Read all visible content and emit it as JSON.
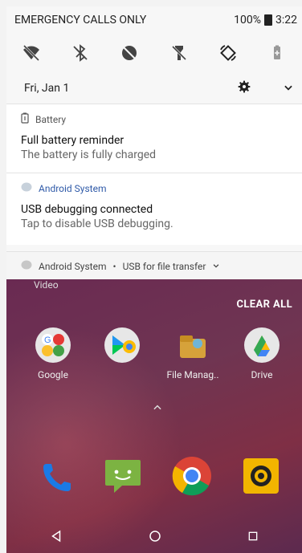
{
  "status_bar": {
    "carrier_text": "EMERGENCY CALLS ONLY",
    "battery_percent": "100%",
    "time": "3:22"
  },
  "quick_settings": {
    "date": "Fri, Jan 1"
  },
  "notifications": [
    {
      "app": "Battery",
      "title": "Full battery reminder",
      "text": "The battery is fully charged"
    },
    {
      "app": "Android System",
      "title": "USB debugging connected",
      "text": "Tap to disable USB debugging."
    }
  ],
  "footer_notification": {
    "app": "Android System",
    "separator": "•",
    "text": "USB for file transfer"
  },
  "recents": {
    "label": "Video",
    "clear_all": "CLEAR ALL"
  },
  "apps": [
    {
      "label": "Google"
    },
    {
      "label": ""
    },
    {
      "label": "File Manag.."
    },
    {
      "label": "Drive"
    }
  ],
  "colors": {
    "accent": "#2f5aa8",
    "wallpaper": "#6f3552"
  }
}
